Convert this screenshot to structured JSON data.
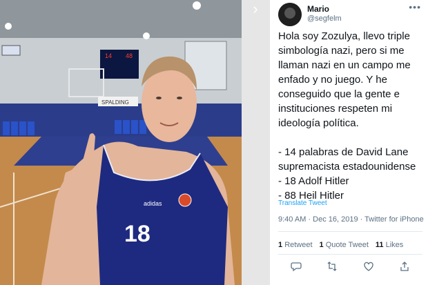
{
  "user": {
    "name": "Mario",
    "handle": "@segfelm"
  },
  "more_icon": "•••",
  "next_icon": "›",
  "tweet_text": "Hola soy Zozulya, llevo triple simbología nazi, pero si me llaman nazi en un campo me enfado y no juego. Y he conseguido que la gente e instituciones respeten mi ideología política.\n\n- 14 palabras de David Lane supremacista estadounidense\n- 18 Adolf Hitler\n- 88 Heil Hitler",
  "translate_label": "Translate Tweet",
  "meta": "9:40 AM · Dec 16, 2019 · Twitter for iPhone",
  "stats": {
    "retweets_count": "1",
    "retweets_label": "Retweet",
    "quotes_count": "1",
    "quotes_label": "Quote Tweet",
    "likes_count": "11",
    "likes_label": "Likes"
  },
  "jersey": {
    "number": "18",
    "brand": "adidas"
  },
  "scoreboard": {
    "left": "14",
    "right": "48"
  },
  "banner_text": "SPALDING",
  "icons": [
    "reply-icon",
    "retweet-icon",
    "like-icon",
    "share-icon"
  ],
  "colors": {
    "link": "#1da1f2",
    "jersey": "#1e2a80",
    "court": "#c48a4c"
  }
}
